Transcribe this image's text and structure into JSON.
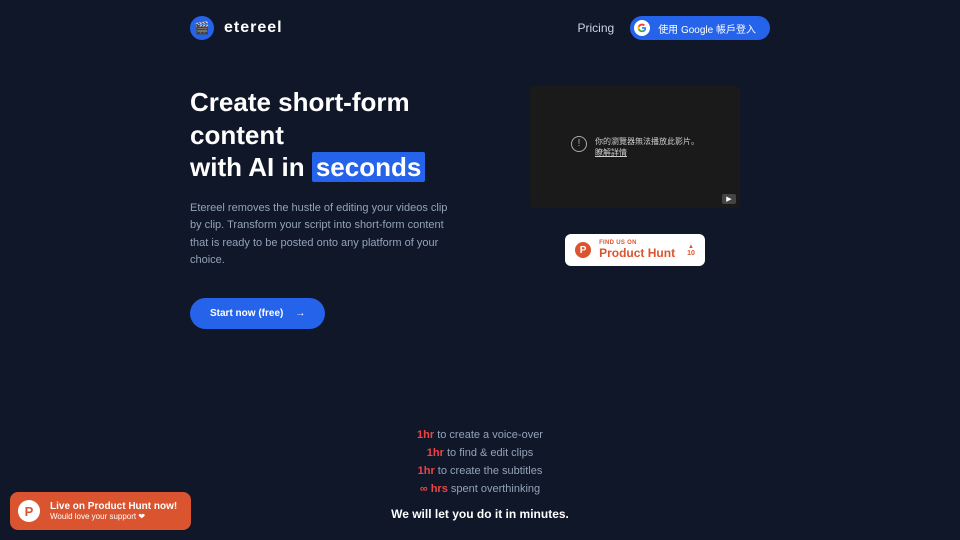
{
  "header": {
    "logo_text": "etereel",
    "pricing": "Pricing",
    "google_login": "使用 Google 帳戶登入"
  },
  "hero": {
    "title_line1": "Create short-form content",
    "title_line2_pre": "with AI in ",
    "title_highlight": "seconds",
    "description": "Etereel removes the hustle of editing your videos clip by clip. Transform your script into short-form content that is ready to be posted onto any platform of your choice.",
    "start_button": "Start now (free)"
  },
  "video": {
    "error_line1": "你的瀏覽器無法播放此影片。",
    "error_link": "瞭解詳情"
  },
  "product_hunt": {
    "small_text": "FIND US ON",
    "big_text": "Product Hunt",
    "count": "10"
  },
  "mid": {
    "lines": [
      {
        "red": "1hr",
        "text": " to create a voice-over"
      },
      {
        "red": "1hr",
        "text": " to find & edit clips"
      },
      {
        "red": "1hr",
        "text": " to create the subtitles"
      },
      {
        "red": "∞ hrs",
        "text": " spent overthinking"
      }
    ],
    "bold": "We will let you do it in minutes."
  },
  "float": {
    "title": "Live on Product Hunt now!",
    "subtitle": "Would love your support ❤"
  }
}
